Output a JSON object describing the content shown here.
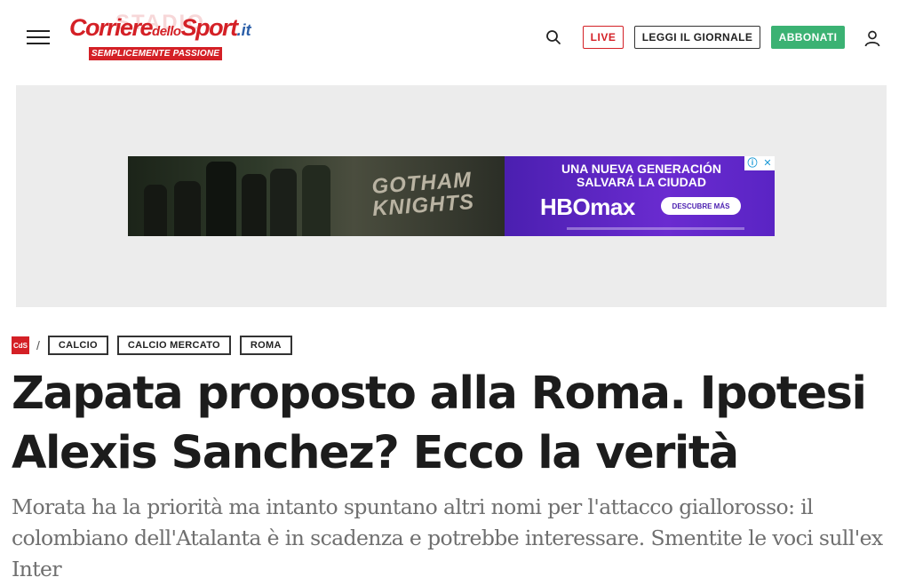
{
  "header": {
    "logo": {
      "word1": "Corriere",
      "word2": "dello",
      "word3": "Sport",
      "tld": ".it",
      "ghost": "STADIO",
      "tagline": "SEMPLICEMENTE PASSIONE"
    },
    "icons": {
      "menu": "hamburger-menu-icon",
      "search": "search-icon",
      "user": "user-icon"
    },
    "live_label": "LIVE",
    "giornale_label": "LEGGI IL GIORNALE",
    "abbonati_label": "ABBONATI",
    "colors": {
      "brand_red": "#d42026",
      "abbonati_green": "#3bb273"
    }
  },
  "ad": {
    "left_title": "GOTHAM KNIGHTS",
    "headline": "UNA NUEVA GENERACIÓN SALVARÁ LA CIUDAD",
    "brand": "HBOmax",
    "cta": "DESCUBRE MÁS",
    "choices_icons": [
      "info-icon",
      "close-icon"
    ],
    "colors": {
      "hbo_purple": "#5a24c4"
    }
  },
  "breadcrumb": {
    "home_logo": "CdS",
    "separator": "/",
    "items": [
      "CALCIO",
      "CALCIO MERCATO",
      "ROMA"
    ]
  },
  "article": {
    "title": "Zapata proposto alla Roma. Ipotesi Alexis Sanchez? Ecco la verità",
    "subtitle": "Morata ha la priorità ma intanto spuntano altri nomi per l'attacco giallorosso: il colombiano dell'Atalanta è in scadenza e potrebbe interessare. Smentite le voci sull'ex Inter"
  }
}
